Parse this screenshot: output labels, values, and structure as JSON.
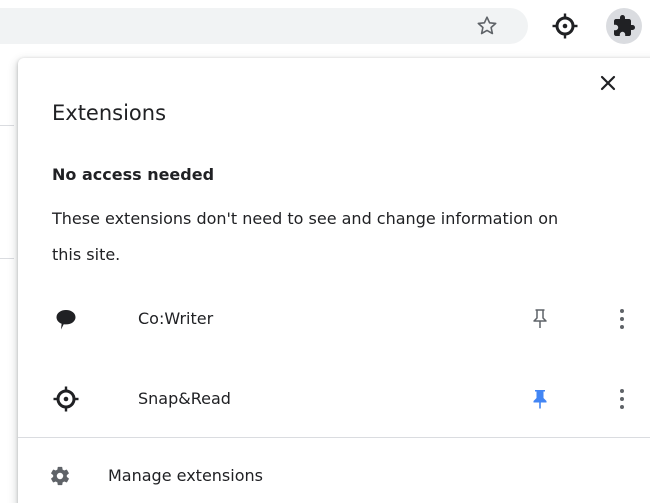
{
  "toolbar": {
    "star_icon": "star-outline-icon",
    "snap_icon": "crosshair-icon",
    "extensions_icon": "puzzle-icon"
  },
  "popup": {
    "title": "Extensions",
    "close_icon": "close-icon",
    "section": {
      "heading": "No access needed",
      "description": "These extensions don't need to see and change information on this site."
    },
    "extensions": [
      {
        "name": "Co:Writer",
        "icon": "speech-bubble-icon",
        "pinned": false,
        "pin_color": "#5f6368"
      },
      {
        "name": "Snap&Read",
        "icon": "crosshair-icon",
        "pinned": true,
        "pin_color": "#4285f4"
      }
    ],
    "manage": {
      "label": "Manage extensions",
      "icon": "gear-icon"
    }
  },
  "colors": {
    "text": "#202124",
    "icon": "#5f6368",
    "pin_active": "#4285f4",
    "omnibox_bg": "#f1f3f4",
    "divider": "#dadce0"
  }
}
